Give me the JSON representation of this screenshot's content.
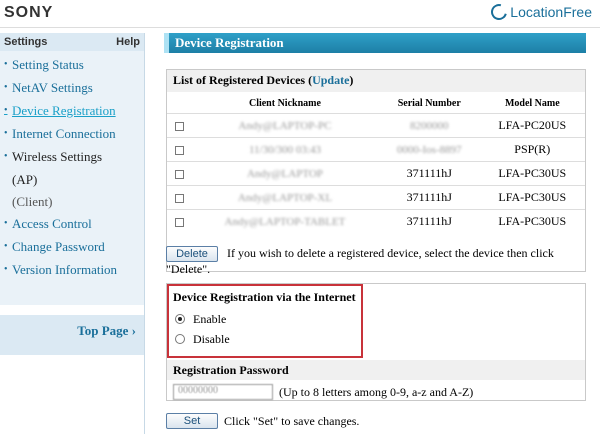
{
  "header": {
    "brand": "SONY",
    "product": "LocationFree"
  },
  "sidebar": {
    "title": "Settings",
    "help": "Help",
    "items": [
      {
        "label": "Setting Status"
      },
      {
        "label": "NetAV Settings"
      },
      {
        "label": "Device Registration"
      },
      {
        "label": "Internet Connection"
      },
      {
        "label": "Wireless Settings"
      },
      {
        "label": "Access Control"
      },
      {
        "label": "Change Password"
      },
      {
        "label": "Version Information"
      }
    ],
    "wireless_sub1": "(AP)",
    "wireless_sub2": "(Client)",
    "top_page": "Top Page"
  },
  "main": {
    "title": "Device Registration",
    "list_title": "List of Registered Devices",
    "update_link": "Update",
    "columns": {
      "nickname": "Client Nickname",
      "serial": "Serial Number",
      "model": "Model Name"
    },
    "devices": [
      {
        "nickname": "Andy@LAPTOP-PC",
        "serial": "8200000",
        "model": "LFA-PC20US"
      },
      {
        "nickname": "11/30/300 03:43",
        "serial": "0000-Ios-8897",
        "model": "PSP(R)"
      },
      {
        "nickname": "Andy@LAPTOP",
        "serial": "371111hJ",
        "model": "LFA-PC30US"
      },
      {
        "nickname": "Andy@LAPTOP-XL",
        "serial": "371111hJ",
        "model": "LFA-PC30US"
      },
      {
        "nickname": "Andy@LAPTOP-TABLET",
        "serial": "371111hJ",
        "model": "LFA-PC30US"
      }
    ],
    "delete_label": "Delete",
    "delete_hint": "If you wish to delete a registered device, select the device then click \"Delete\".",
    "internet_title": "Device Registration via the Internet",
    "enable_label": "Enable",
    "disable_label": "Disable",
    "enabled": true,
    "password_title": "Registration Password",
    "password_value": "00000000",
    "password_hint": "(Up to 8 letters among 0-9, a-z and A-Z)",
    "set_label": "Set",
    "set_hint": "Click \"Set\" to save changes."
  }
}
